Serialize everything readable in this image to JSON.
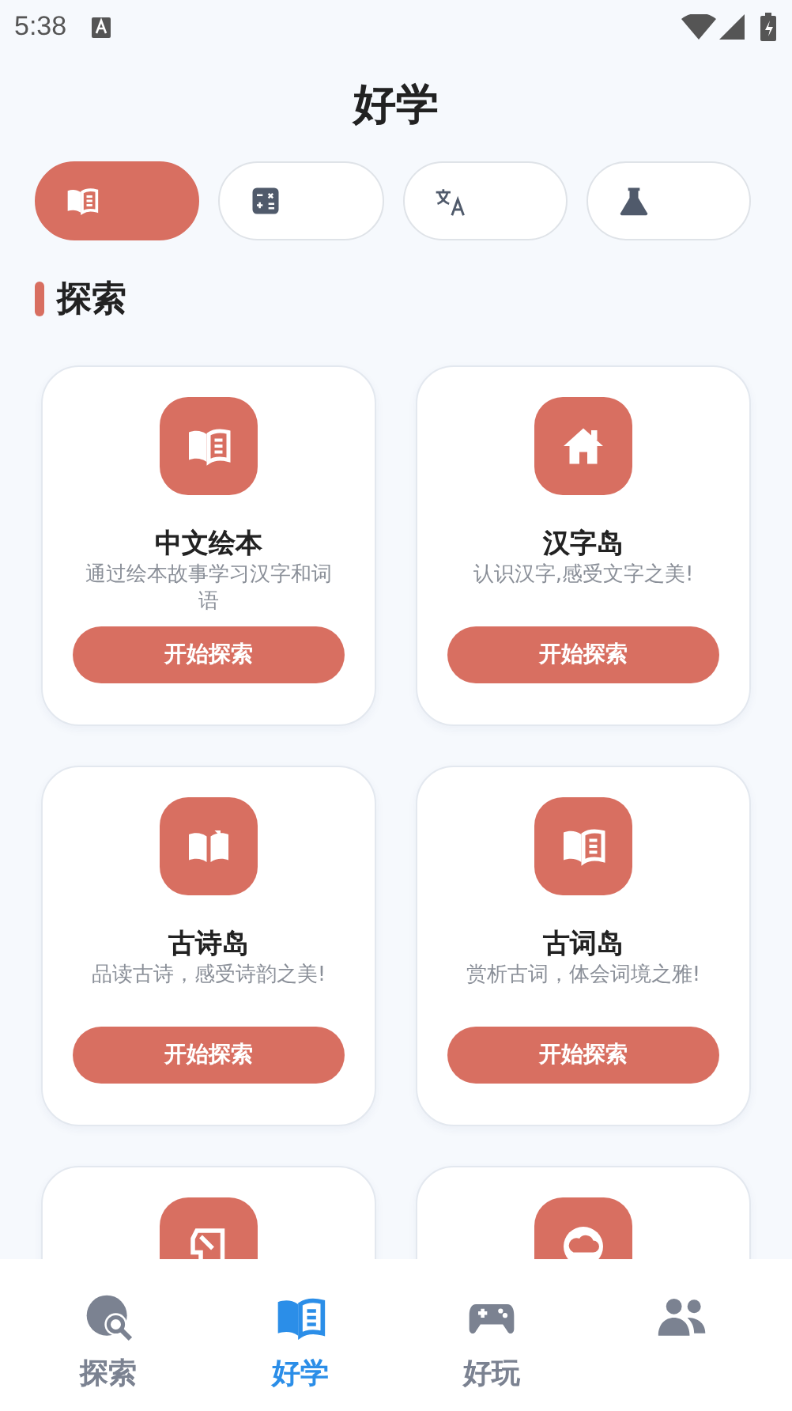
{
  "status_bar": {
    "time": "5:38"
  },
  "title": "好学",
  "category_tabs": [
    {
      "selected": true
    },
    {
      "selected": false
    },
    {
      "selected": false
    },
    {
      "selected": false
    }
  ],
  "section": {
    "title": "探索"
  },
  "cards": [
    {
      "kind": "full",
      "title": "中文绘本",
      "description": "通过绘本故事学习汉字和词语",
      "button": "开始探索"
    },
    {
      "kind": "full",
      "title": "汉字岛",
      "description": "认识汉字,感受文字之美!",
      "button": "开始探索"
    },
    {
      "kind": "full",
      "title": "古诗岛",
      "description": "品读古诗，感受诗韵之美!",
      "button": "开始探索"
    },
    {
      "kind": "full",
      "title": "古词岛",
      "description": "赏析古词，体会词境之雅!",
      "button": "开始探索"
    },
    {
      "kind": "cut"
    },
    {
      "kind": "cut"
    }
  ],
  "bottom_nav": [
    {
      "label": "探索",
      "selected": false
    },
    {
      "label": "好学",
      "selected": true
    },
    {
      "label": "好玩",
      "selected": false
    },
    {
      "selected": false
    }
  ]
}
